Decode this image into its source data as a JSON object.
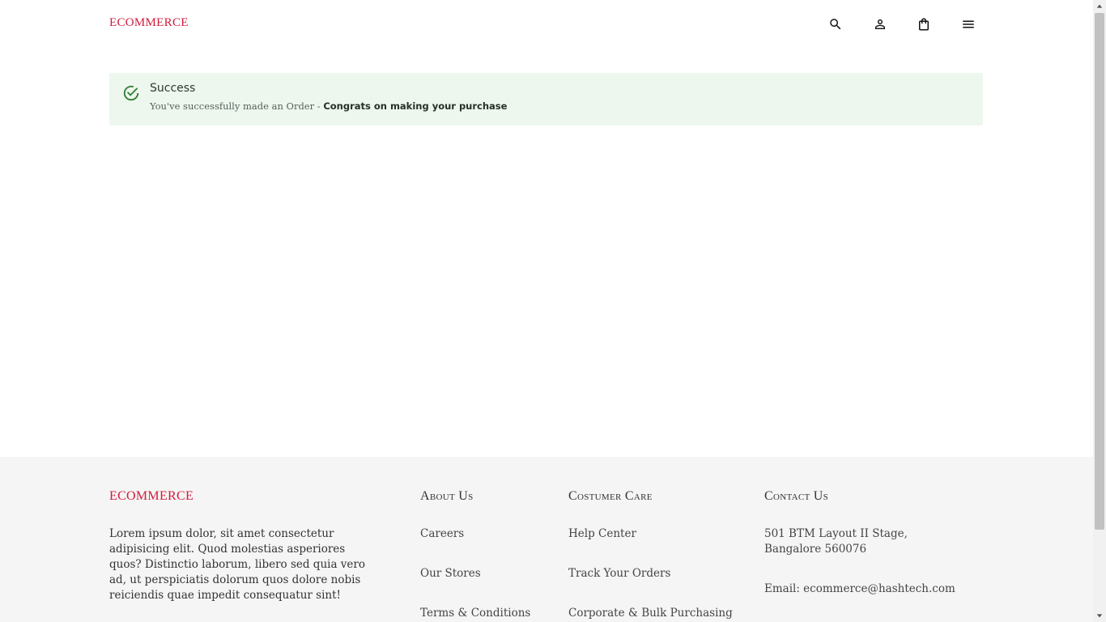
{
  "header": {
    "brand": "ECOMMERCE",
    "icons": [
      "search-icon",
      "user-icon",
      "shopping-bag-icon",
      "menu-icon"
    ]
  },
  "alert": {
    "title": "Success",
    "message": "You've successfully made an Order -",
    "emphasis": "Congrats on making your purchase",
    "color": "#2e7d32",
    "background": "#edf7ee"
  },
  "footer": {
    "brand": "ECOMMERCE",
    "description": "Lorem ipsum dolor, sit amet consectetur adipisicing elit. Quod molestias asperiores quos? Distinctio laborum, libero sed quia vero ad, ut perspiciatis dolorum quos dolore nobis reiciendis quae impedit consequatur sint!",
    "about": {
      "title": "About Us",
      "links": [
        "Careers",
        "Our Stores",
        "Terms & Conditions"
      ]
    },
    "care": {
      "title": "Costumer Care",
      "links": [
        "Help Center",
        "Track Your Orders",
        "Corporate & Bulk Purchasing"
      ]
    },
    "contact": {
      "title": "Contact Us",
      "address": "501 BTM Layout II Stage, Bangalore 560076",
      "email": "Email: ecommerce@hashtech.com"
    }
  },
  "colors": {
    "brand": "#d11b3c",
    "footer_bg": "#f5f5f5"
  }
}
